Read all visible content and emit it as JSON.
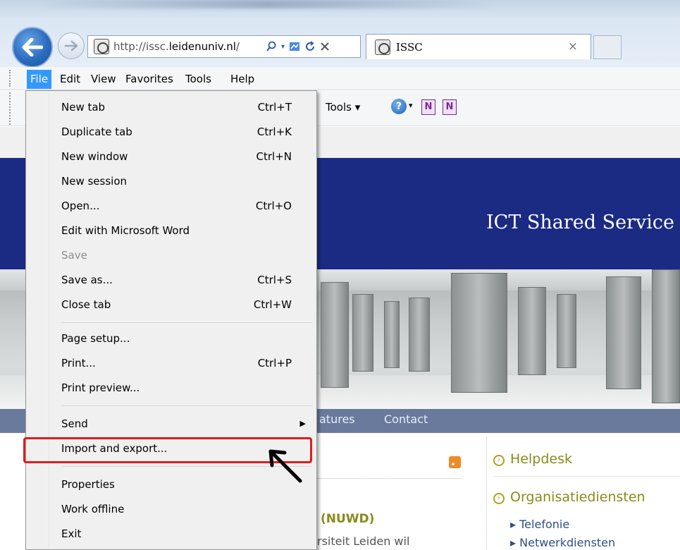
{
  "browser": {
    "url_prefix": "http://issc.",
    "url_domain": "leidenuniv.nl",
    "url_suffix": "/",
    "tab_title": "ISSC",
    "tab_close_glyph": "×"
  },
  "menubar": {
    "items": [
      "File",
      "Edit",
      "View",
      "Favorites",
      "Tools",
      "Help"
    ],
    "active": "File"
  },
  "commandbar": {
    "tools_label": "Tools ▾"
  },
  "file_menu": {
    "items": [
      {
        "label": "New tab",
        "shortcut": "Ctrl+T"
      },
      {
        "label": "Duplicate tab",
        "shortcut": "Ctrl+K"
      },
      {
        "label": "New window",
        "shortcut": "Ctrl+N"
      },
      {
        "label": "New session",
        "shortcut": ""
      },
      {
        "label": "Open...",
        "shortcut": "Ctrl+O"
      },
      {
        "label": "Edit with Microsoft Word",
        "shortcut": ""
      },
      {
        "label": "Save",
        "shortcut": "",
        "disabled": true
      },
      {
        "label": "Save as...",
        "shortcut": "Ctrl+S"
      },
      {
        "label": "Close tab",
        "shortcut": "Ctrl+W"
      },
      {
        "label": "Page setup...",
        "shortcut": ""
      },
      {
        "label": "Print...",
        "shortcut": "Ctrl+P"
      },
      {
        "label": "Print preview...",
        "shortcut": ""
      },
      {
        "label": "Send",
        "shortcut": "",
        "submenu": true
      },
      {
        "label": "Import and export...",
        "shortcut": "",
        "highlighted": true
      },
      {
        "label": "Properties",
        "shortcut": ""
      },
      {
        "label": "Work offline",
        "shortcut": ""
      },
      {
        "label": "Exit",
        "shortcut": ""
      }
    ]
  },
  "webpage": {
    "banner_title": "ICT Shared Service",
    "nav": [
      "atures",
      "Contact"
    ],
    "sidebar": {
      "helpdesk": "Helpdesk",
      "organisatiediensten": "Organisatiediensten",
      "links": [
        "Telefonie",
        "Netwerkdiensten"
      ]
    },
    "article_title": "(NUWD)",
    "article_text": "rsiteit Leiden wil"
  },
  "colors": {
    "menu_highlight_border": "#e11d1d",
    "active_menu": "#3399ff",
    "banner": "#1b2a82",
    "navbar": "#6a7a9c",
    "olive_heading": "#8a8a1c"
  }
}
